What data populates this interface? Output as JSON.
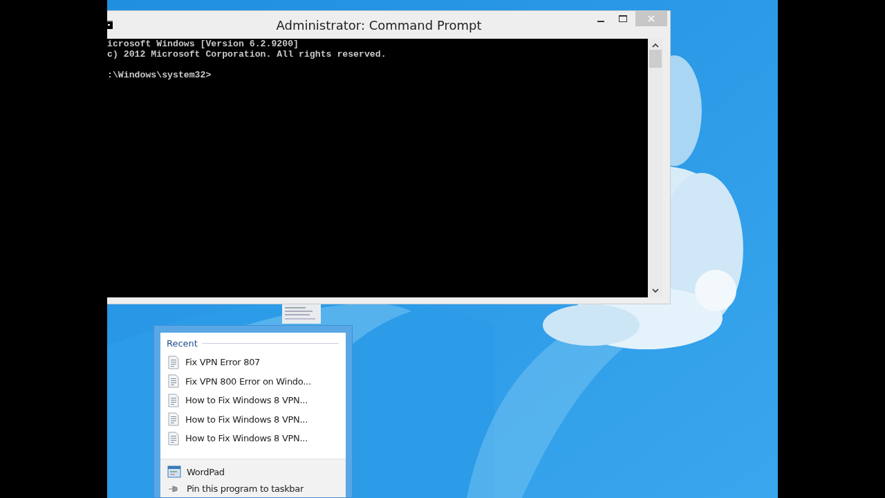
{
  "console_window": {
    "title": "Administrator: Command Prompt",
    "blocks": [
      [
        "icrosoft Windows [Version 6.2.9200]",
        "c) 2012 Microsoft Corporation. All rights reserved."
      ],
      [
        ":\\Windows\\system32>"
      ]
    ]
  },
  "jump_list": {
    "section": "Recent",
    "recent": [
      {
        "label": "Fix VPN Error 807"
      },
      {
        "label": "Fix VPN 800 Error on Windo..."
      },
      {
        "label": "How to Fix Windows 8 VPN..."
      },
      {
        "label": "How to Fix Windows 8 VPN..."
      },
      {
        "label": "How to Fix Windows 8 VPN..."
      }
    ],
    "tasks": [
      {
        "label": "WordPad",
        "kind": "app"
      },
      {
        "label": "Pin this program to taskbar",
        "kind": "pin"
      }
    ]
  }
}
